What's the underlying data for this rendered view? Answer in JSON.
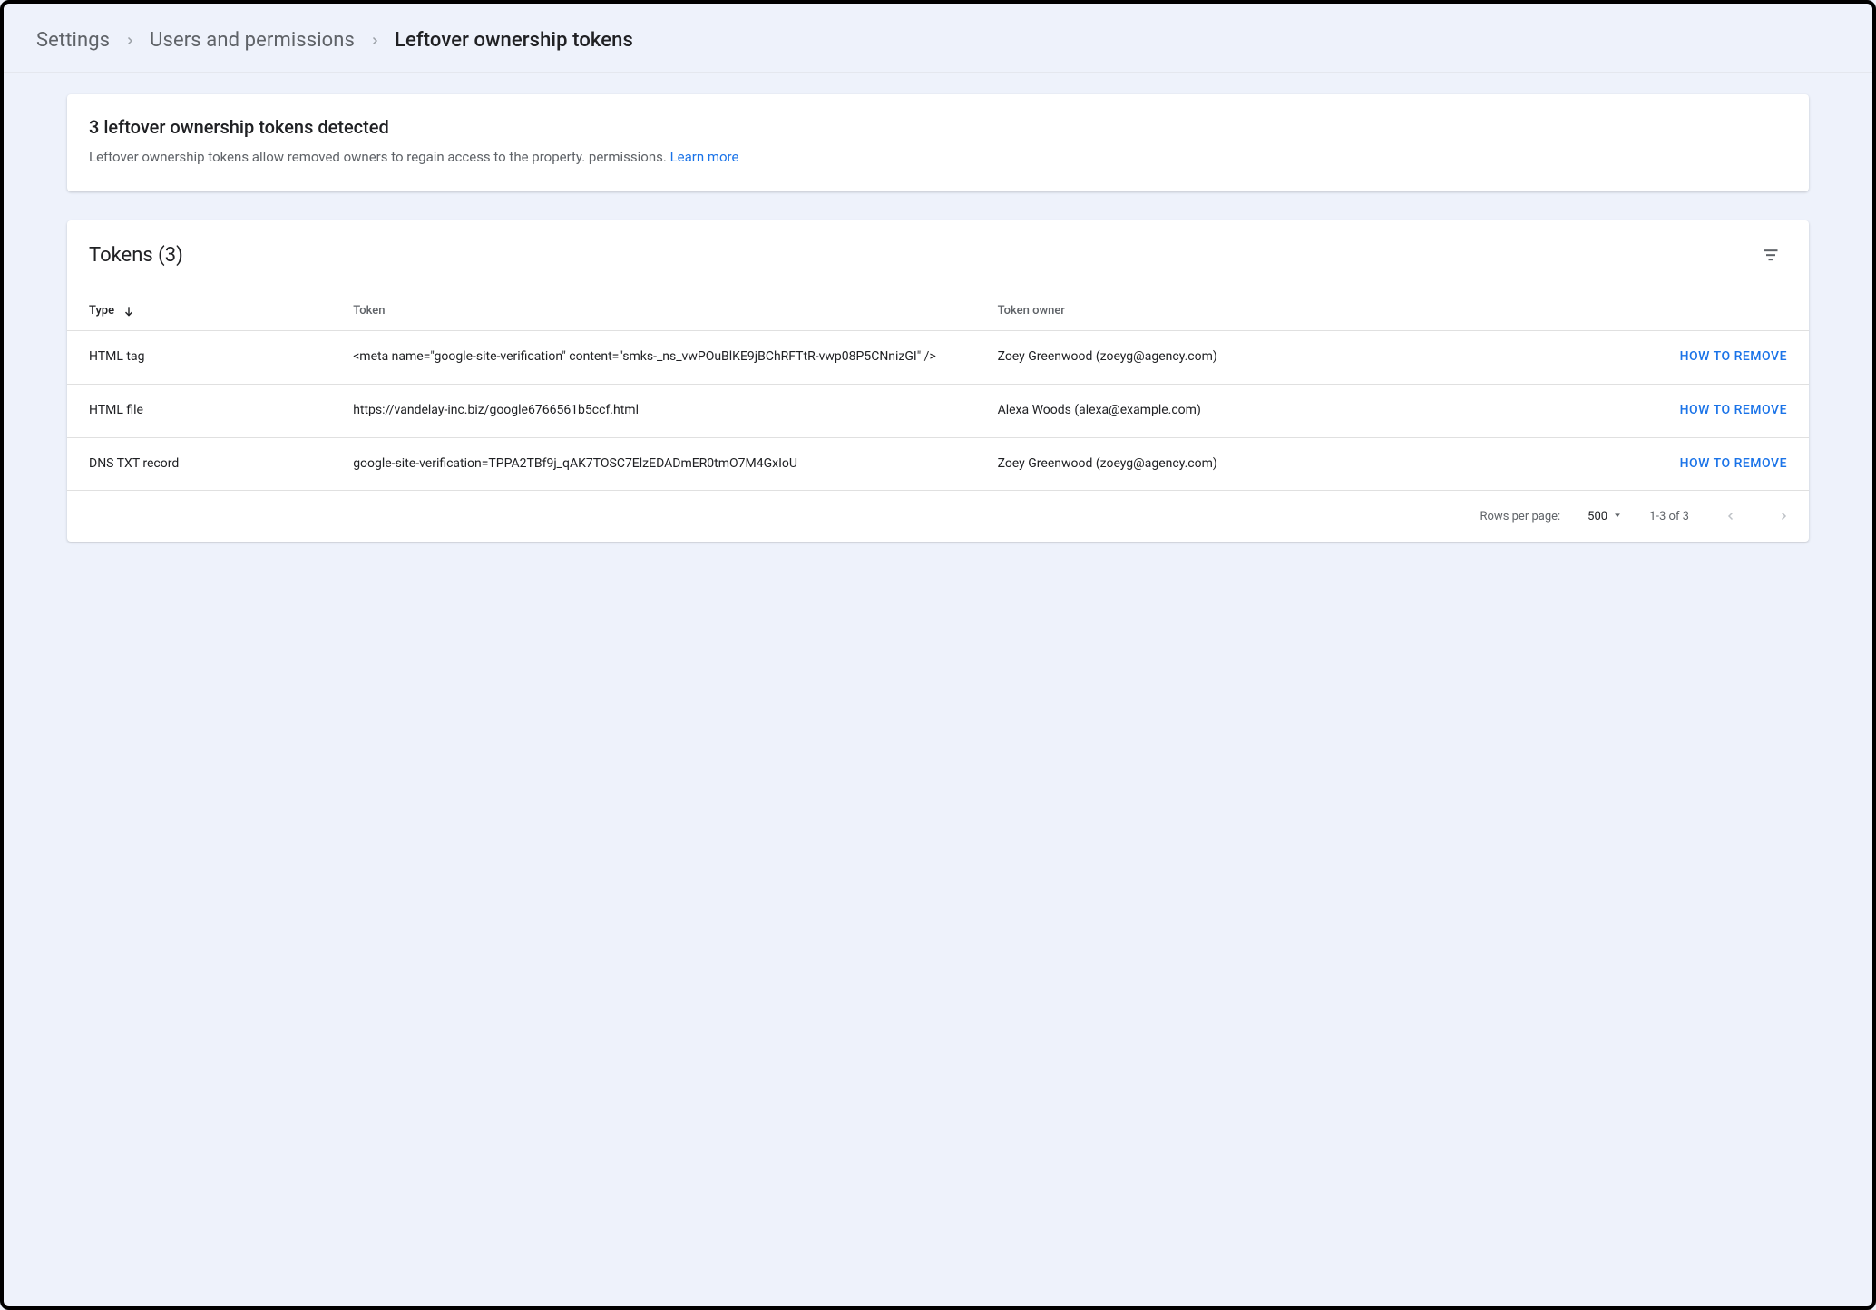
{
  "breadcrumb": {
    "items": [
      {
        "label": "Settings"
      },
      {
        "label": "Users and permissions"
      },
      {
        "label": "Leftover ownership tokens"
      }
    ]
  },
  "banner": {
    "title": "3 leftover ownership tokens detected",
    "body_prefix": "Leftover ownership tokens allow removed owners to regain access to the property. permissions. ",
    "learn_more": "Learn more"
  },
  "table": {
    "title": "Tokens (3)",
    "columns": {
      "type": "Type",
      "token": "Token",
      "owner": "Token owner",
      "action": ""
    },
    "action_label": "HOW TO REMOVE",
    "rows": [
      {
        "type": "HTML tag",
        "token": "<meta name=\"google-site-verification\" content=\"smks-_ns_vwPOuBlKE9jBChRFTtR-vwp08P5CNnizGI\" />",
        "owner": "Zoey Greenwood (zoeyg@agency.com)"
      },
      {
        "type": "HTML file",
        "token": "https://vandelay-inc.biz/google6766561b5ccf.html",
        "owner": "Alexa Woods (alexa@example.com)"
      },
      {
        "type": "DNS TXT record",
        "token": "google-site-verification=TPPA2TBf9j_qAK7TOSC7ElzEDADmER0tmO7M4GxIoU",
        "owner": "Zoey Greenwood (zoeyg@agency.com)"
      }
    ],
    "footer": {
      "rows_per_page_label": "Rows per page:",
      "rows_per_page_value": "500",
      "range_label": "1-3 of 3"
    }
  }
}
